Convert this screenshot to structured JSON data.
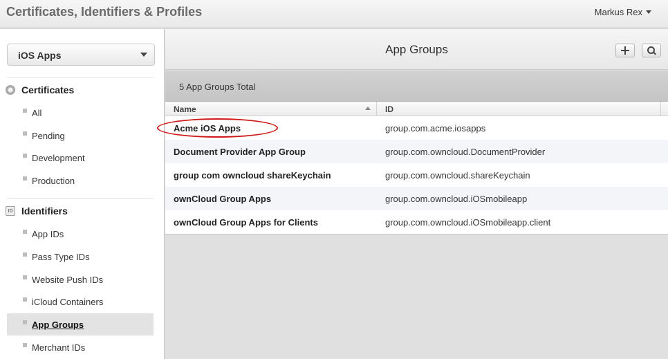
{
  "header": {
    "title": "Certificates, Identifiers & Profiles",
    "user": "Markus Rex"
  },
  "sidebar": {
    "platform_select": "iOS Apps",
    "sections": [
      {
        "title": "Certificates",
        "icon": "certificate-icon",
        "items": [
          {
            "label": "All"
          },
          {
            "label": "Pending"
          },
          {
            "label": "Development"
          },
          {
            "label": "Production"
          }
        ]
      },
      {
        "title": "Identifiers",
        "icon": "id-icon",
        "items": [
          {
            "label": "App IDs"
          },
          {
            "label": "Pass Type IDs"
          },
          {
            "label": "Website Push IDs"
          },
          {
            "label": "iCloud Containers"
          },
          {
            "label": "App Groups",
            "active": true
          },
          {
            "label": "Merchant IDs"
          }
        ]
      }
    ]
  },
  "main": {
    "title": "App Groups",
    "summary": "5 App Groups Total",
    "columns": {
      "name": "Name",
      "id": "ID"
    },
    "rows": [
      {
        "name": "Acme iOS Apps",
        "id": "group.com.acme.iosapps"
      },
      {
        "name": "Document Provider App Group",
        "id": "group.com.owncloud.DocumentProvider"
      },
      {
        "name": "group com owncloud shareKeychain",
        "id": "group.com.owncloud.shareKeychain"
      },
      {
        "name": "ownCloud Group Apps",
        "id": "group.com.owncloud.iOSmobileapp"
      },
      {
        "name": "ownCloud Group Apps for Clients",
        "id": "group.com.owncloud.iOSmobileapp.client"
      }
    ]
  },
  "colors": {
    "annotation": "#d01a1a",
    "row_alt": "#f3f5f9",
    "active_nav": "#e3e3e3"
  }
}
